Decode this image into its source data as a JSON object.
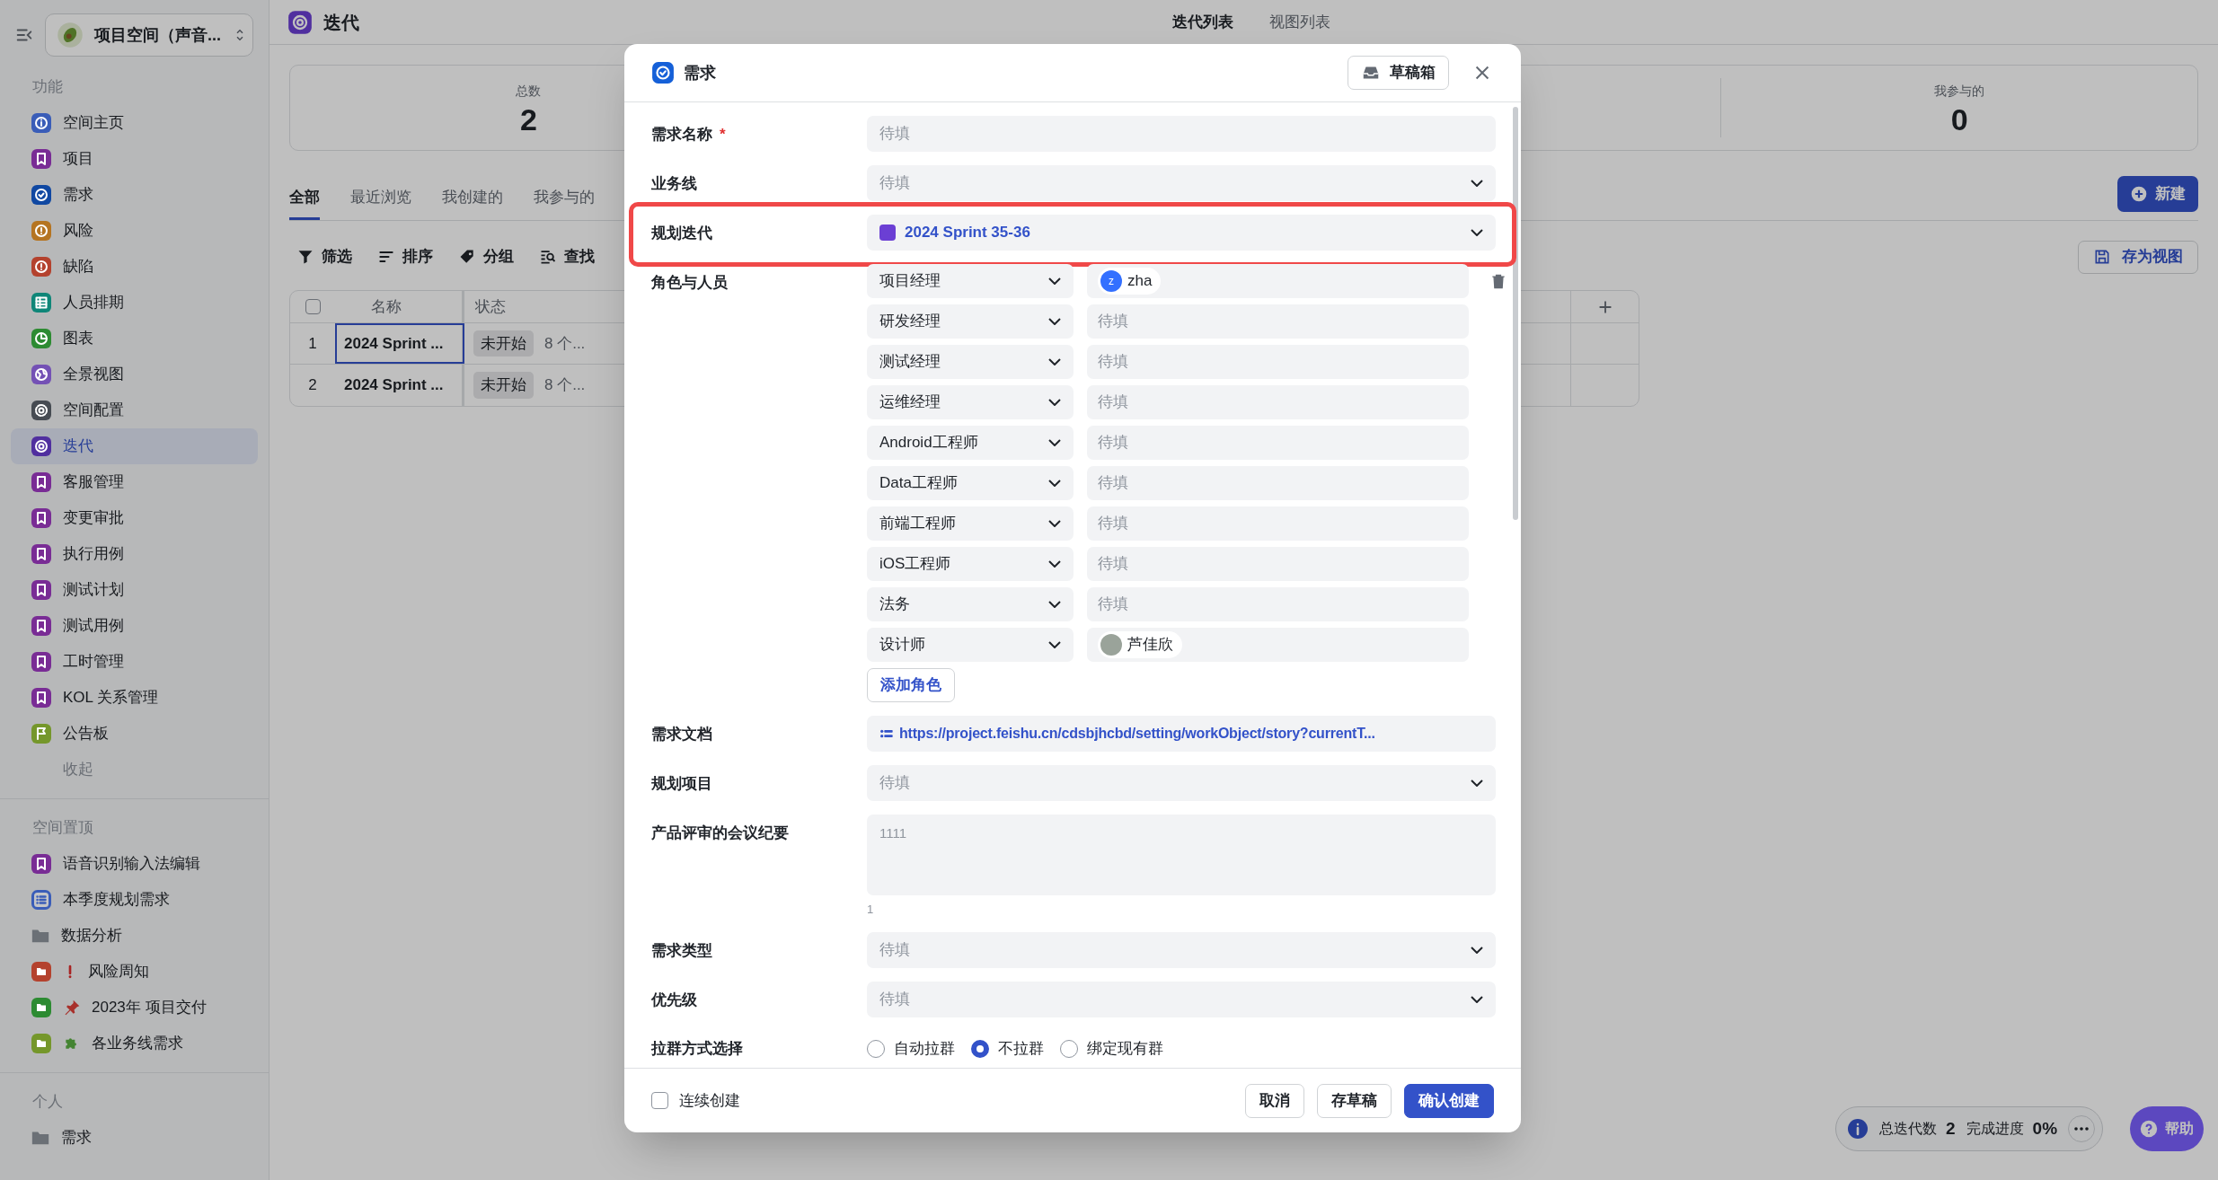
{
  "sidebar": {
    "space_name": "项目空间（声音...",
    "sections": [
      {
        "title": "功能",
        "items": [
          {
            "label": "空间主页",
            "kind": "info",
            "color": "#3a5db8",
            "selected": false
          },
          {
            "label": "项目",
            "kind": "bookmark",
            "color": "#792c95",
            "selected": false
          },
          {
            "label": "需求",
            "kind": "check",
            "color": "#1048a2",
            "selected": false
          },
          {
            "label": "风险",
            "kind": "alert",
            "color": "#b57421",
            "selected": false
          },
          {
            "label": "缺陷",
            "kind": "alert",
            "color": "#b4422e",
            "selected": false
          },
          {
            "label": "人员排期",
            "kind": "grid",
            "color": "#0f8678",
            "selected": false
          },
          {
            "label": "图表",
            "kind": "chart",
            "color": "#2d8b32",
            "selected": false
          },
          {
            "label": "全景视图",
            "kind": "globe",
            "color": "#7451b5",
            "selected": false
          },
          {
            "label": "空间配置",
            "kind": "gear",
            "color": "#464b52",
            "selected": false
          },
          {
            "label": "迭代",
            "kind": "target",
            "color": "#502f9f",
            "selected": true
          },
          {
            "label": "客服管理",
            "kind": "bookmark",
            "color": "#792c95",
            "selected": false
          },
          {
            "label": "变更审批",
            "kind": "bookmark",
            "color": "#792c95",
            "selected": false
          },
          {
            "label": "执行用例",
            "kind": "bookmark",
            "color": "#792c95",
            "selected": false
          },
          {
            "label": "测试计划",
            "kind": "bookmark",
            "color": "#792c95",
            "selected": false
          },
          {
            "label": "测试用例",
            "kind": "bookmark",
            "color": "#792c95",
            "selected": false
          },
          {
            "label": "工时管理",
            "kind": "bookmark",
            "color": "#792c95",
            "selected": false
          },
          {
            "label": "KOL 关系管理",
            "kind": "bookmark",
            "color": "#792c95",
            "selected": false
          },
          {
            "label": "公告板",
            "kind": "flag",
            "color": "#75972b",
            "selected": false
          }
        ],
        "collapse": "收起"
      },
      {
        "title": "空间置顶",
        "items": [
          {
            "label": "语音识别输入法编辑",
            "kind": "bookmark",
            "color": "#792c95",
            "selected": false
          },
          {
            "label": "本季度规划需求",
            "kind": "list",
            "color": "#3a5db8",
            "selected": false
          },
          {
            "label": "数据分析",
            "kind": "folder",
            "color": "#6b7076",
            "selected": false
          },
          {
            "label": "风险周知",
            "kind": "folder-alert",
            "color": "#b4422e",
            "selected": false
          },
          {
            "label": "2023年 项目交付",
            "kind": "folder-pin",
            "color": "#2d8b32",
            "selected": false
          },
          {
            "label": "各业务线需求",
            "kind": "folder-puzzle",
            "color": "#75972b",
            "selected": false
          }
        ]
      },
      {
        "title": "个人",
        "items": [
          {
            "label": "需求",
            "kind": "folder",
            "color": "#6b7076",
            "selected": false
          }
        ]
      }
    ]
  },
  "page_header": {
    "title": "迭代",
    "view_tabs": [
      {
        "label": "迭代列表",
        "selected": true
      },
      {
        "label": "视图列表",
        "selected": false
      }
    ]
  },
  "stats": [
    {
      "label": "总数",
      "value": "2"
    },
    {
      "label": "我参与的",
      "value": "0"
    }
  ],
  "filter_tabs": [
    {
      "label": "全部",
      "selected": true
    },
    {
      "label": "最近浏览",
      "selected": false
    },
    {
      "label": "我创建的",
      "selected": false
    },
    {
      "label": "我参与的",
      "selected": false
    }
  ],
  "new_button": "新建",
  "toolbar": [
    {
      "label": "筛选",
      "kind": "filter"
    },
    {
      "label": "排序",
      "kind": "sort"
    },
    {
      "label": "分组",
      "kind": "tag"
    },
    {
      "label": "查找",
      "kind": "find"
    }
  ],
  "save_view_button": "存为视图",
  "table": {
    "select_all_checked": false,
    "columns": [
      "名称",
      "状态"
    ],
    "rows": [
      {
        "index": "1",
        "name": "2024 Sprint ...",
        "status": "未开始",
        "column_3": "8 个...",
        "selected": true
      },
      {
        "index": "2",
        "name": "2024 Sprint ...",
        "status": "未开始",
        "column_3": "8 个...",
        "selected": false
      }
    ]
  },
  "summary": [
    {
      "label": "总迭代数",
      "value": "2"
    },
    {
      "label": "完成进度",
      "value": "0%"
    }
  ],
  "help_button": "帮助",
  "modal": {
    "title": "需求",
    "drafts_button": "草稿箱",
    "fields": [
      {
        "kind": "text",
        "label": "需求名称",
        "required_mark": "*",
        "placeholder": "待填"
      },
      {
        "kind": "select",
        "label": "业务线",
        "placeholder": "待填"
      },
      {
        "kind": "iteration",
        "label": "规划迭代",
        "value": "2024 Sprint 35-36",
        "color": "#6b3fd4",
        "highlighted": true
      },
      {
        "kind": "roles",
        "label": "角色与人员",
        "add_button": "添加角色",
        "roles": [
          {
            "role": "项目经理",
            "person": {
              "name": "zha",
              "avatar_text": "z"
            }
          },
          {
            "role": "研发经理",
            "placeholder": "待填"
          },
          {
            "role": "测试经理",
            "placeholder": "待填"
          },
          {
            "role": "运维经理",
            "placeholder": "待填"
          },
          {
            "role": "Android工程师",
            "placeholder": "待填"
          },
          {
            "role": "Data工程师",
            "placeholder": "待填"
          },
          {
            "role": "前端工程师",
            "placeholder": "待填"
          },
          {
            "role": "iOS工程师",
            "placeholder": "待填"
          },
          {
            "role": "法务",
            "placeholder": "待填"
          },
          {
            "role": "设计师",
            "person": {
              "name": "芦佳欣"
            }
          }
        ]
      },
      {
        "kind": "link",
        "label": "需求文档",
        "value": "https://project.feishu.cn/cdsbjhcbd/setting/workObject/story?currentT..."
      },
      {
        "kind": "select",
        "label": "规划项目",
        "placeholder": "待填"
      },
      {
        "kind": "textarea",
        "label": "产品评审的会议纪要",
        "placeholder": "1111",
        "counter": "1"
      },
      {
        "kind": "select",
        "label": "需求类型",
        "placeholder": "待填"
      },
      {
        "kind": "select",
        "label": "优先级",
        "placeholder": "待填"
      },
      {
        "kind": "radio",
        "label": "拉群方式选择",
        "options": [
          {
            "label": "自动拉群",
            "selected": false
          },
          {
            "label": "不拉群",
            "selected": true
          },
          {
            "label": "绑定现有群",
            "selected": false
          }
        ]
      }
    ],
    "continuous_create": {
      "label": "连续创建",
      "checked": false
    },
    "buttons": [
      {
        "label": "取消",
        "kind": "default"
      },
      {
        "label": "存草稿",
        "kind": "default"
      },
      {
        "label": "确认创建",
        "kind": "primary"
      }
    ]
  }
}
